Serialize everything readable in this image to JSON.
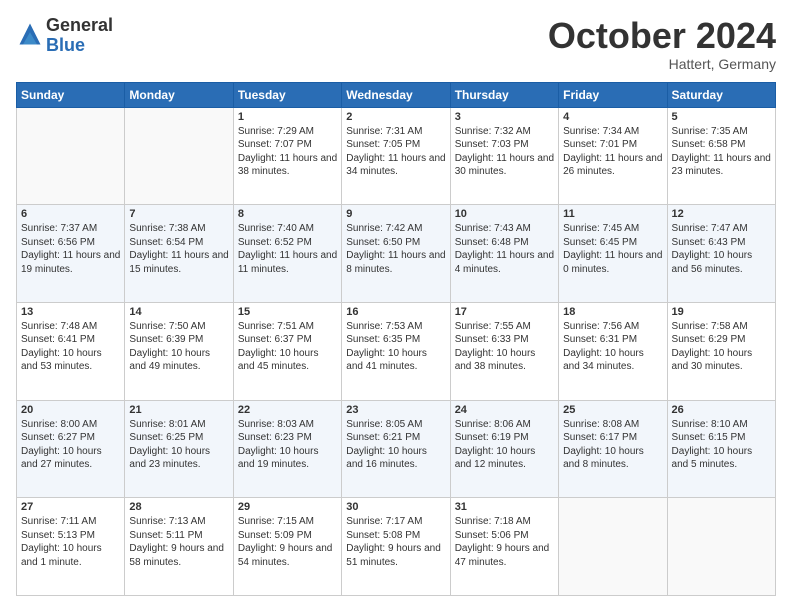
{
  "logo": {
    "general": "General",
    "blue": "Blue"
  },
  "header": {
    "month": "October 2024",
    "location": "Hattert, Germany"
  },
  "weekdays": [
    "Sunday",
    "Monday",
    "Tuesday",
    "Wednesday",
    "Thursday",
    "Friday",
    "Saturday"
  ],
  "weeks": [
    [
      {
        "day": "",
        "sunrise": "",
        "sunset": "",
        "daylight": ""
      },
      {
        "day": "",
        "sunrise": "",
        "sunset": "",
        "daylight": ""
      },
      {
        "day": "1",
        "sunrise": "Sunrise: 7:29 AM",
        "sunset": "Sunset: 7:07 PM",
        "daylight": "Daylight: 11 hours and 38 minutes."
      },
      {
        "day": "2",
        "sunrise": "Sunrise: 7:31 AM",
        "sunset": "Sunset: 7:05 PM",
        "daylight": "Daylight: 11 hours and 34 minutes."
      },
      {
        "day": "3",
        "sunrise": "Sunrise: 7:32 AM",
        "sunset": "Sunset: 7:03 PM",
        "daylight": "Daylight: 11 hours and 30 minutes."
      },
      {
        "day": "4",
        "sunrise": "Sunrise: 7:34 AM",
        "sunset": "Sunset: 7:01 PM",
        "daylight": "Daylight: 11 hours and 26 minutes."
      },
      {
        "day": "5",
        "sunrise": "Sunrise: 7:35 AM",
        "sunset": "Sunset: 6:58 PM",
        "daylight": "Daylight: 11 hours and 23 minutes."
      }
    ],
    [
      {
        "day": "6",
        "sunrise": "Sunrise: 7:37 AM",
        "sunset": "Sunset: 6:56 PM",
        "daylight": "Daylight: 11 hours and 19 minutes."
      },
      {
        "day": "7",
        "sunrise": "Sunrise: 7:38 AM",
        "sunset": "Sunset: 6:54 PM",
        "daylight": "Daylight: 11 hours and 15 minutes."
      },
      {
        "day": "8",
        "sunrise": "Sunrise: 7:40 AM",
        "sunset": "Sunset: 6:52 PM",
        "daylight": "Daylight: 11 hours and 11 minutes."
      },
      {
        "day": "9",
        "sunrise": "Sunrise: 7:42 AM",
        "sunset": "Sunset: 6:50 PM",
        "daylight": "Daylight: 11 hours and 8 minutes."
      },
      {
        "day": "10",
        "sunrise": "Sunrise: 7:43 AM",
        "sunset": "Sunset: 6:48 PM",
        "daylight": "Daylight: 11 hours and 4 minutes."
      },
      {
        "day": "11",
        "sunrise": "Sunrise: 7:45 AM",
        "sunset": "Sunset: 6:45 PM",
        "daylight": "Daylight: 11 hours and 0 minutes."
      },
      {
        "day": "12",
        "sunrise": "Sunrise: 7:47 AM",
        "sunset": "Sunset: 6:43 PM",
        "daylight": "Daylight: 10 hours and 56 minutes."
      }
    ],
    [
      {
        "day": "13",
        "sunrise": "Sunrise: 7:48 AM",
        "sunset": "Sunset: 6:41 PM",
        "daylight": "Daylight: 10 hours and 53 minutes."
      },
      {
        "day": "14",
        "sunrise": "Sunrise: 7:50 AM",
        "sunset": "Sunset: 6:39 PM",
        "daylight": "Daylight: 10 hours and 49 minutes."
      },
      {
        "day": "15",
        "sunrise": "Sunrise: 7:51 AM",
        "sunset": "Sunset: 6:37 PM",
        "daylight": "Daylight: 10 hours and 45 minutes."
      },
      {
        "day": "16",
        "sunrise": "Sunrise: 7:53 AM",
        "sunset": "Sunset: 6:35 PM",
        "daylight": "Daylight: 10 hours and 41 minutes."
      },
      {
        "day": "17",
        "sunrise": "Sunrise: 7:55 AM",
        "sunset": "Sunset: 6:33 PM",
        "daylight": "Daylight: 10 hours and 38 minutes."
      },
      {
        "day": "18",
        "sunrise": "Sunrise: 7:56 AM",
        "sunset": "Sunset: 6:31 PM",
        "daylight": "Daylight: 10 hours and 34 minutes."
      },
      {
        "day": "19",
        "sunrise": "Sunrise: 7:58 AM",
        "sunset": "Sunset: 6:29 PM",
        "daylight": "Daylight: 10 hours and 30 minutes."
      }
    ],
    [
      {
        "day": "20",
        "sunrise": "Sunrise: 8:00 AM",
        "sunset": "Sunset: 6:27 PM",
        "daylight": "Daylight: 10 hours and 27 minutes."
      },
      {
        "day": "21",
        "sunrise": "Sunrise: 8:01 AM",
        "sunset": "Sunset: 6:25 PM",
        "daylight": "Daylight: 10 hours and 23 minutes."
      },
      {
        "day": "22",
        "sunrise": "Sunrise: 8:03 AM",
        "sunset": "Sunset: 6:23 PM",
        "daylight": "Daylight: 10 hours and 19 minutes."
      },
      {
        "day": "23",
        "sunrise": "Sunrise: 8:05 AM",
        "sunset": "Sunset: 6:21 PM",
        "daylight": "Daylight: 10 hours and 16 minutes."
      },
      {
        "day": "24",
        "sunrise": "Sunrise: 8:06 AM",
        "sunset": "Sunset: 6:19 PM",
        "daylight": "Daylight: 10 hours and 12 minutes."
      },
      {
        "day": "25",
        "sunrise": "Sunrise: 8:08 AM",
        "sunset": "Sunset: 6:17 PM",
        "daylight": "Daylight: 10 hours and 8 minutes."
      },
      {
        "day": "26",
        "sunrise": "Sunrise: 8:10 AM",
        "sunset": "Sunset: 6:15 PM",
        "daylight": "Daylight: 10 hours and 5 minutes."
      }
    ],
    [
      {
        "day": "27",
        "sunrise": "Sunrise: 7:11 AM",
        "sunset": "Sunset: 5:13 PM",
        "daylight": "Daylight: 10 hours and 1 minute."
      },
      {
        "day": "28",
        "sunrise": "Sunrise: 7:13 AM",
        "sunset": "Sunset: 5:11 PM",
        "daylight": "Daylight: 9 hours and 58 minutes."
      },
      {
        "day": "29",
        "sunrise": "Sunrise: 7:15 AM",
        "sunset": "Sunset: 5:09 PM",
        "daylight": "Daylight: 9 hours and 54 minutes."
      },
      {
        "day": "30",
        "sunrise": "Sunrise: 7:17 AM",
        "sunset": "Sunset: 5:08 PM",
        "daylight": "Daylight: 9 hours and 51 minutes."
      },
      {
        "day": "31",
        "sunrise": "Sunrise: 7:18 AM",
        "sunset": "Sunset: 5:06 PM",
        "daylight": "Daylight: 9 hours and 47 minutes."
      },
      {
        "day": "",
        "sunrise": "",
        "sunset": "",
        "daylight": ""
      },
      {
        "day": "",
        "sunrise": "",
        "sunset": "",
        "daylight": ""
      }
    ]
  ]
}
